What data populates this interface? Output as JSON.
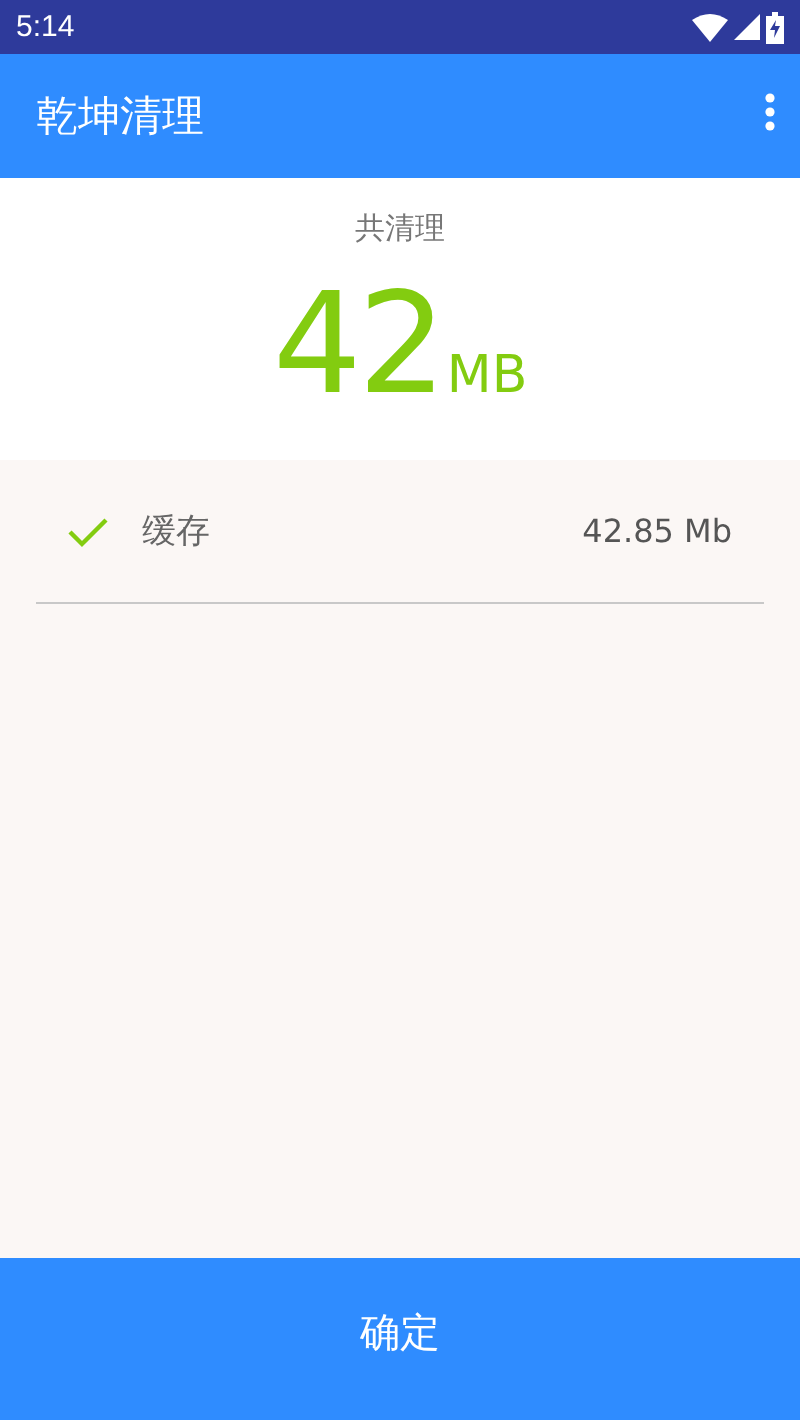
{
  "status_bar": {
    "time": "5:14"
  },
  "app_bar": {
    "title": "乾坤清理"
  },
  "summary": {
    "label": "共清理",
    "amount": "42",
    "unit": "MB"
  },
  "items": [
    {
      "label": "缓存",
      "size": "42.85 Mb",
      "checked": true
    }
  ],
  "confirm_button": {
    "label": "确定"
  }
}
